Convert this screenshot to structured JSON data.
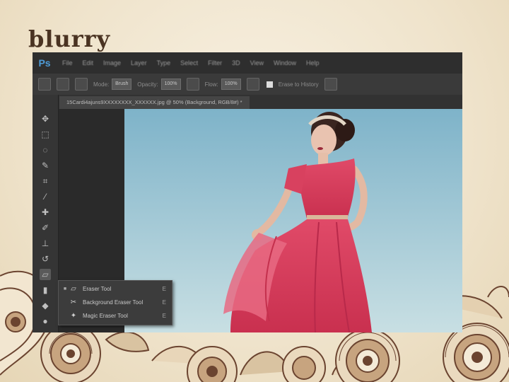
{
  "slide": {
    "title": "blurry"
  },
  "app": {
    "logo": "Ps",
    "menu": [
      "File",
      "Edit",
      "Image",
      "Layer",
      "Type",
      "Select",
      "Filter",
      "3D",
      "View",
      "Window",
      "Help"
    ],
    "options": {
      "mode_label": "Mode:",
      "mode_value": "Brush",
      "opacity_label": "Opacity:",
      "opacity_value": "100%",
      "flow_label": "Flow:",
      "flow_value": "100%",
      "erase_history_label": "Erase to History"
    },
    "document_tab": "15Cardi4ajuns9XXXXXXXX_XXXXXX.jpg @ 50% (Background, RGB/8#) *",
    "flyout": [
      {
        "label": "Eraser Tool",
        "key": "E",
        "icon": "eraser-icon"
      },
      {
        "label": "Background Eraser Tool",
        "key": "E",
        "icon": "background-eraser-icon"
      },
      {
        "label": "Magic Eraser Tool",
        "key": "E",
        "icon": "magic-eraser-icon"
      }
    ]
  },
  "colors": {
    "accent": "#4e9bd6",
    "dress": "#d8415f",
    "sky_top": "#7eb3c9",
    "sky_bottom": "#c8dfe3",
    "deco_brown": "#6b4430"
  }
}
